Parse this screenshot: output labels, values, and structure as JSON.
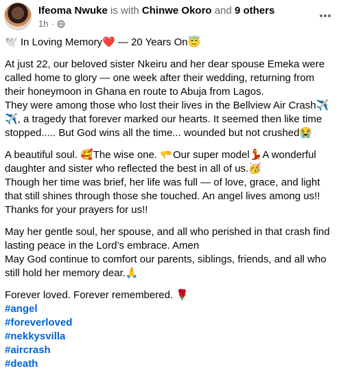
{
  "post": {
    "author": "Ifeoma Nwuke",
    "with_text": "is with",
    "tagged": "Chinwe Okoro",
    "and_text": "and",
    "others": "9 others",
    "time": "1h",
    "dot": "·",
    "privacy_icon": "globe-icon",
    "more_icon": "more-horizontal-icon"
  },
  "content": {
    "title": "🕊️ In Loving Memory❤️ — 20 Years On😇",
    "p1": [
      "At just 22, our beloved sister Nkeiru and her dear spouse Emeka were",
      "called home to glory — one week after their wedding, returning from",
      "their honeymoon in Ghana en route to Abuja from Lagos.",
      "They were among those who lost their lives in the Bellview Air Crash✈️",
      "✈️, a tragedy that forever marked our hearts. It seemed then like time",
      "stopped..... But God wins all the time... wounded but not crushed😭"
    ],
    "p2": [
      "A beautiful soul. 🥰The wise one. 🫳Our super model💃A wonderful",
      "daughter and sister who reflected the best in all of us.🥳",
      "Though her time was brief, her life was full — of love, grace, and light",
      "that still shines through those she touched. An angel lives among us!!",
      "Thanks for your prayers for us!!"
    ],
    "p3": [
      "May her gentle soul, her spouse, and all who perished in that crash find",
      "lasting peace in the Lord’s embrace. Amen",
      "May God continue to comfort our parents, siblings, friends, and all who",
      "still hold her memory dear.🙏"
    ],
    "p4": "Forever loved. Forever remembered. 🌹",
    "hashtags": [
      "#angel",
      "#foreverloved",
      "#nekkysvilla",
      "#aircrash",
      "#death"
    ]
  }
}
